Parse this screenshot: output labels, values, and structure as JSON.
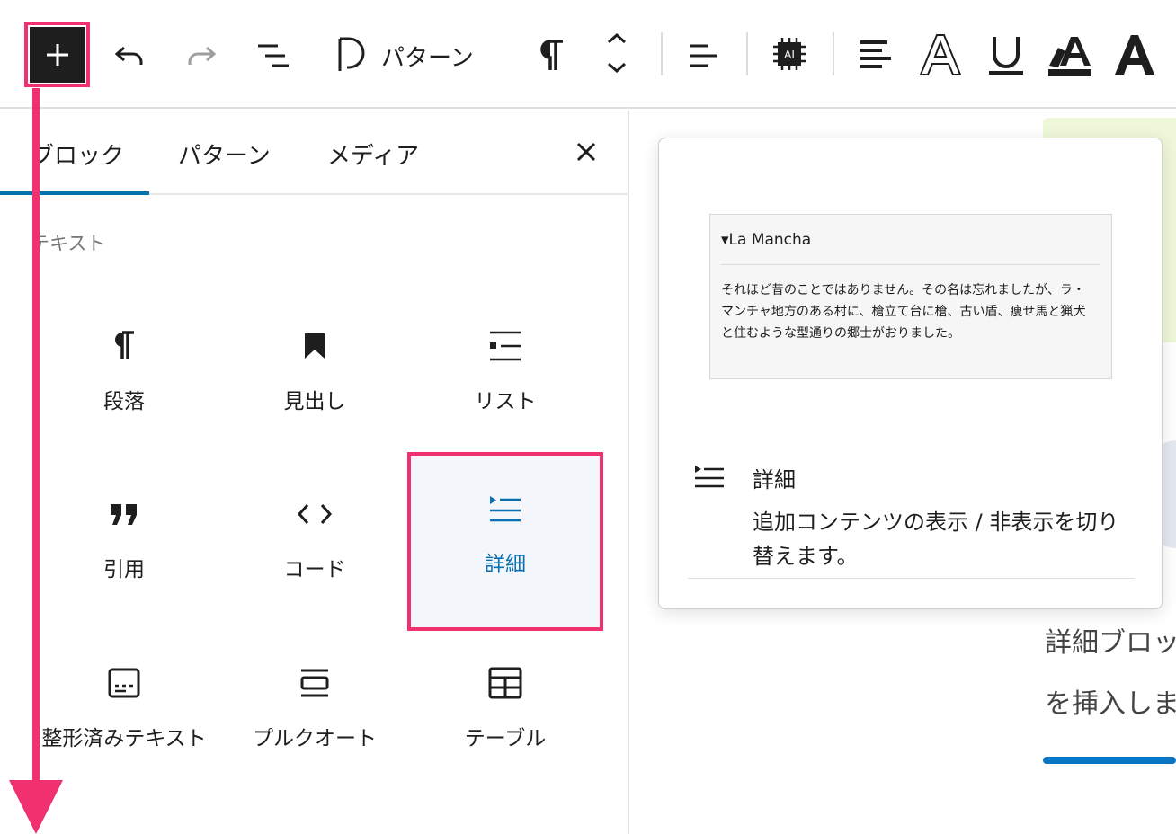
{
  "toolbar": {
    "add_label": "+",
    "pattern_label": "パターン",
    "ai_badge": "AI"
  },
  "inserter": {
    "tabs": [
      "ブロック",
      "パターン",
      "メディア"
    ],
    "category": "テキスト",
    "blocks": [
      {
        "label": "段落",
        "icon": "paragraph-icon"
      },
      {
        "label": "見出し",
        "icon": "bookmark-icon"
      },
      {
        "label": "リスト",
        "icon": "list-icon"
      },
      {
        "label": "引用",
        "icon": "quote-icon"
      },
      {
        "label": "コード",
        "icon": "code-icon"
      },
      {
        "label": "詳細",
        "icon": "details-icon"
      },
      {
        "label": "整形済みテキスト",
        "icon": "preformatted-icon"
      },
      {
        "label": "プルクオート",
        "icon": "pullquote-icon"
      },
      {
        "label": "テーブル",
        "icon": "table-icon"
      }
    ]
  },
  "preview": {
    "summary": "▾La Mancha",
    "body": "それほど昔のことではありません。その名は忘れましたが、ラ・マンチャ地方のある村に、槍立て台に槍、古い盾、痩せ馬と猟犬と住むような型通りの郷士がおりました。",
    "title": "詳細",
    "description": "追加コンテンツの表示 / 非表示を切り替えます。"
  },
  "editor": {
    "line1": "詳細ブロック",
    "line2": "を挿入しま"
  },
  "colors": {
    "highlight": "#f0306f",
    "accent": "#0073aa"
  }
}
